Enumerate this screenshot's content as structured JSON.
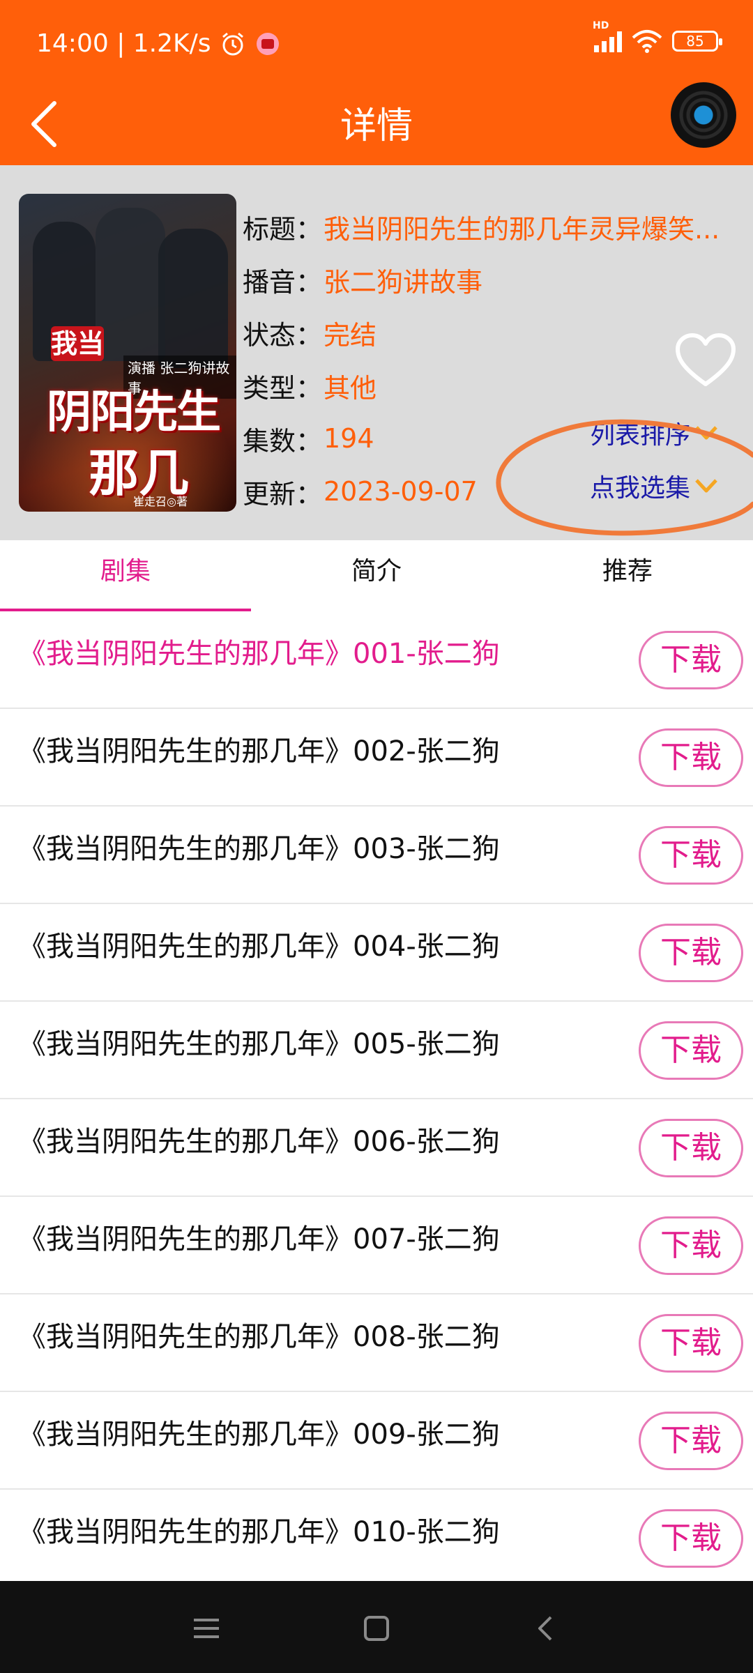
{
  "status_bar": {
    "time_speed": "14:00 | 1.2K/s",
    "hd_label": "HD",
    "battery": "85"
  },
  "header": {
    "title": "详情"
  },
  "book": {
    "cover": {
      "tag": "我当",
      "narrator": "演播 张二狗讲故事",
      "title_line1": "阴阳先生",
      "title_line2": "那几年",
      "author": "崔走召◎著"
    },
    "rows": [
      {
        "label": "标题：",
        "value": "我当阴阳先生的那几年灵异爆笑..."
      },
      {
        "label": "播音：",
        "value": "张二狗讲故事"
      },
      {
        "label": "状态：",
        "value": "完结"
      },
      {
        "label": "类型：",
        "value": "其他"
      },
      {
        "label": "集数：",
        "value": "194"
      },
      {
        "label": "更新：",
        "value": "2023-09-07"
      }
    ],
    "list_sort_label": "列表排序",
    "select_episode_label": "点我选集"
  },
  "tabs": [
    {
      "label": "剧集",
      "active": true
    },
    {
      "label": "简介",
      "active": false
    },
    {
      "label": "推荐",
      "active": false
    }
  ],
  "download_label": "下载",
  "episodes": [
    {
      "title": "《我当阴阳先生的那几年》001-张二狗",
      "active": true
    },
    {
      "title": "《我当阴阳先生的那几年》002-张二狗"
    },
    {
      "title": "《我当阴阳先生的那几年》003-张二狗"
    },
    {
      "title": "《我当阴阳先生的那几年》004-张二狗"
    },
    {
      "title": "《我当阴阳先生的那几年》005-张二狗"
    },
    {
      "title": "《我当阴阳先生的那几年》006-张二狗"
    },
    {
      "title": "《我当阴阳先生的那几年》007-张二狗"
    },
    {
      "title": "《我当阴阳先生的那几年》008-张二狗"
    },
    {
      "title": "《我当阴阳先生的那几年》009-张二狗"
    },
    {
      "title": "《我当阴阳先生的那几年》010-张二狗"
    }
  ],
  "colors": {
    "header_bg": "#FF5F0A",
    "info_bg": "#DCDCDC",
    "accent_pink": "#E21C8C",
    "value_orange": "#FF5F0A",
    "link_blue": "#1A1AA8",
    "chevron_orange": "#F5A623"
  },
  "icons": {
    "back": "back-arrow-icon",
    "vinyl": "vinyl-record-icon",
    "heart": "heart-outline-icon",
    "chevron": "chevron-down-icon",
    "nav": [
      "menu-icon",
      "home-square-icon",
      "back-triangle-icon"
    ]
  }
}
